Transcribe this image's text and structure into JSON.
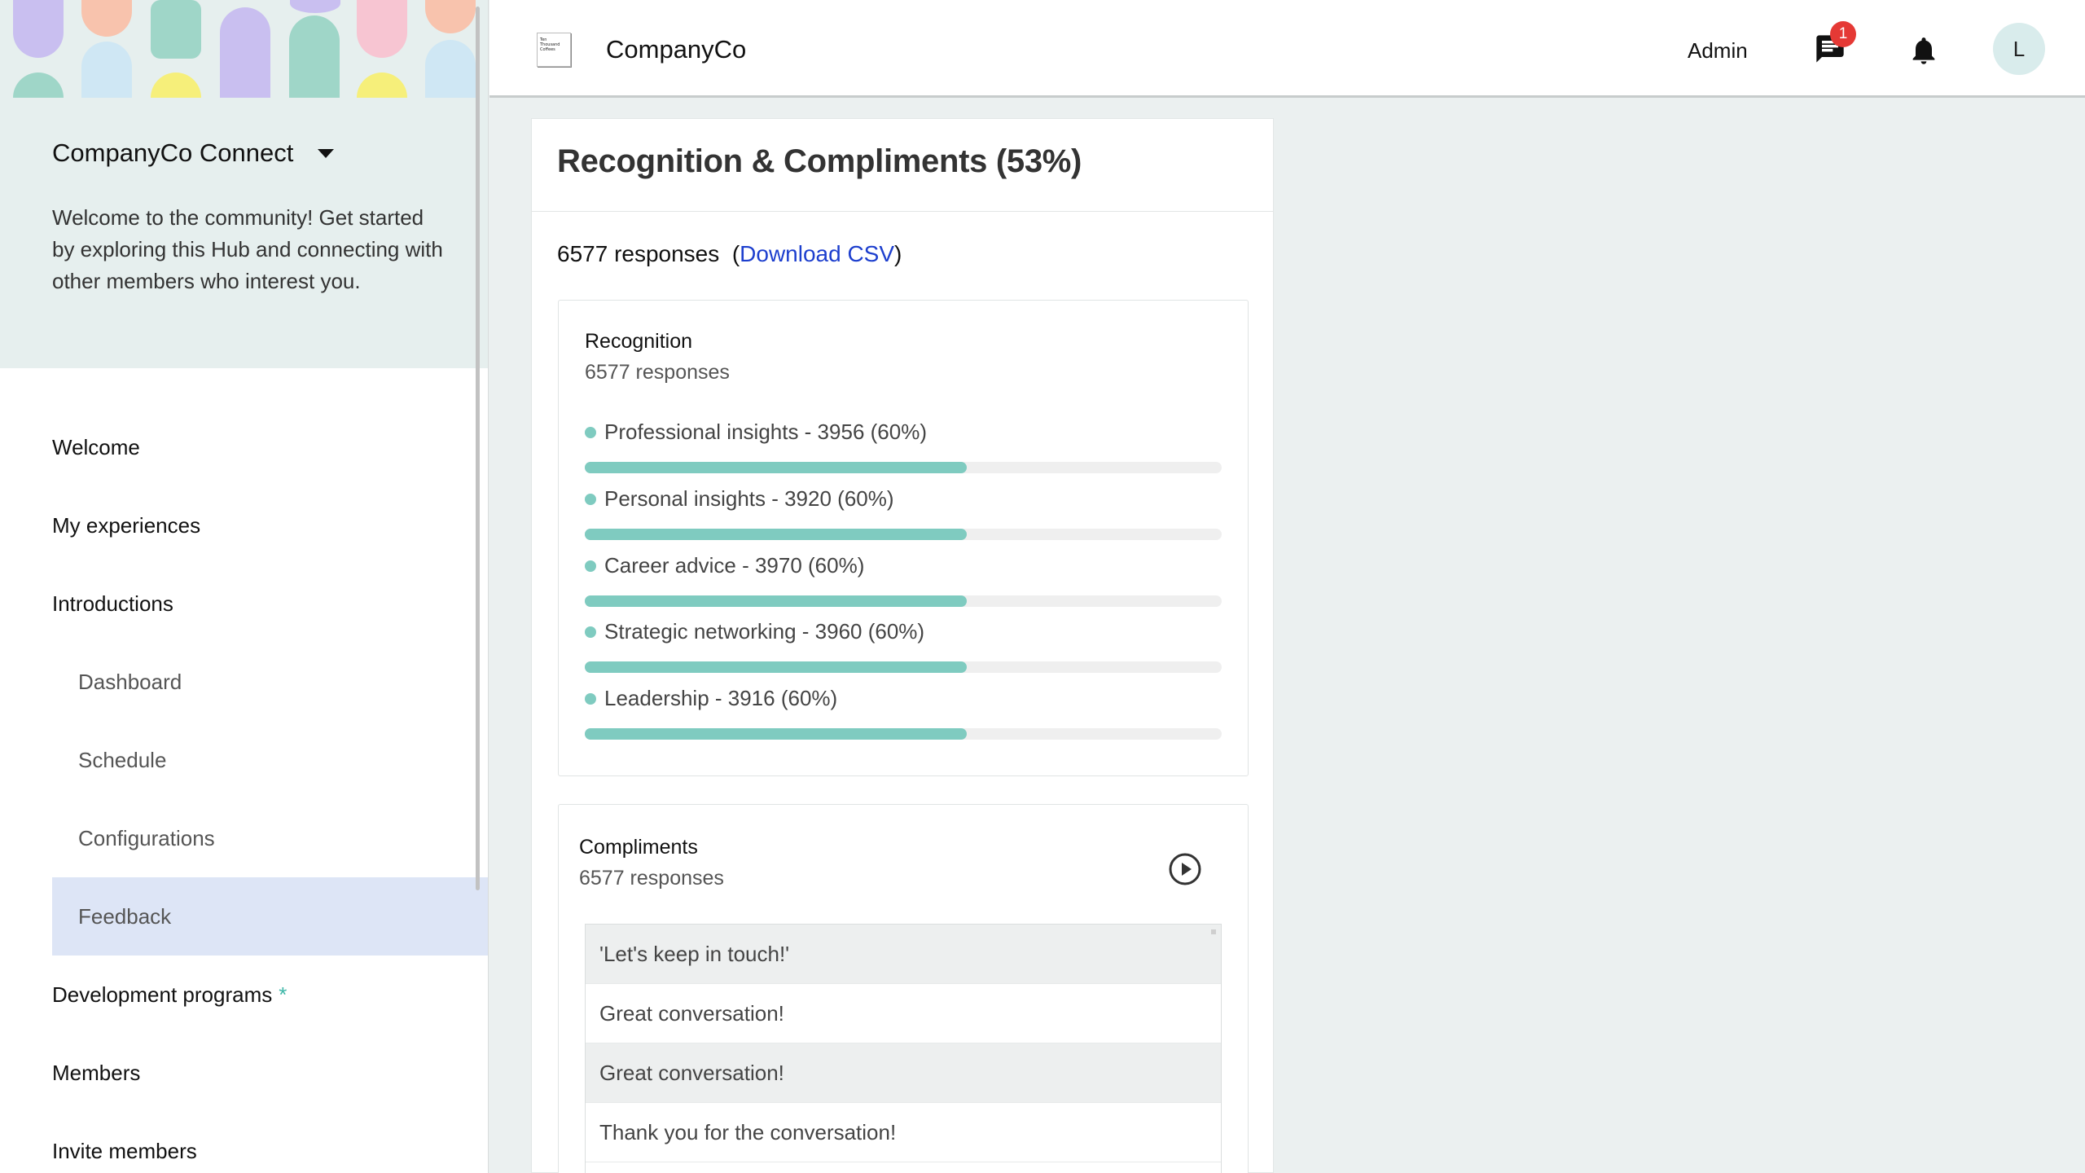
{
  "sidebar": {
    "community_name": "CompanyCo Connect",
    "welcome_text": "Welcome to the community! Get started by exploring this Hub and connecting with other members who interest you.",
    "items": [
      {
        "label": "Welcome"
      },
      {
        "label": "My experiences"
      },
      {
        "label": "Introductions"
      },
      {
        "label": "Dashboard"
      },
      {
        "label": "Schedule"
      },
      {
        "label": "Configurations"
      },
      {
        "label": "Feedback"
      },
      {
        "label": "Development programs",
        "marker": "*"
      },
      {
        "label": "Members"
      },
      {
        "label": "Invite members"
      }
    ]
  },
  "topbar": {
    "logo_text": "Ten Thousand Coffees",
    "company_name": "CompanyCo",
    "admin_label": "Admin",
    "chat_badge_count": "1",
    "avatar_initial": "L"
  },
  "main": {
    "title": "Recognition & Compliments (53%)",
    "responses_text": "6577 responses",
    "open_paren": "(",
    "download_label": "Download CSV",
    "close_paren": ")",
    "recognition": {
      "title": "Recognition",
      "responses": "6577 responses",
      "options": [
        {
          "label": "Professional insights - 3956 (60%)",
          "fraction": 0.6
        },
        {
          "label": "Personal insights - 3920 (60%)",
          "fraction": 0.6
        },
        {
          "label": "Career advice - 3970 (60%)",
          "fraction": 0.6
        },
        {
          "label": "Strategic networking - 3960 (60%)",
          "fraction": 0.6
        },
        {
          "label": "Leadership - 3916 (60%)",
          "fraction": 0.6
        }
      ]
    },
    "compliments": {
      "title": "Compliments",
      "responses": "6577 responses",
      "items": [
        "'Let's keep in touch!'",
        "Great conversation!",
        "Great conversation!",
        "Thank you for the conversation!"
      ]
    }
  },
  "colors": {
    "accent_teal": "#7fcbc0",
    "link_blue": "#1d3fce",
    "active_nav_bg": "#dde5f6",
    "badge_red": "#e53935"
  },
  "icons": {
    "chat": "chat-icon",
    "bell": "bell-icon",
    "play": "play-circle-icon",
    "caret": "caret-down-icon"
  }
}
